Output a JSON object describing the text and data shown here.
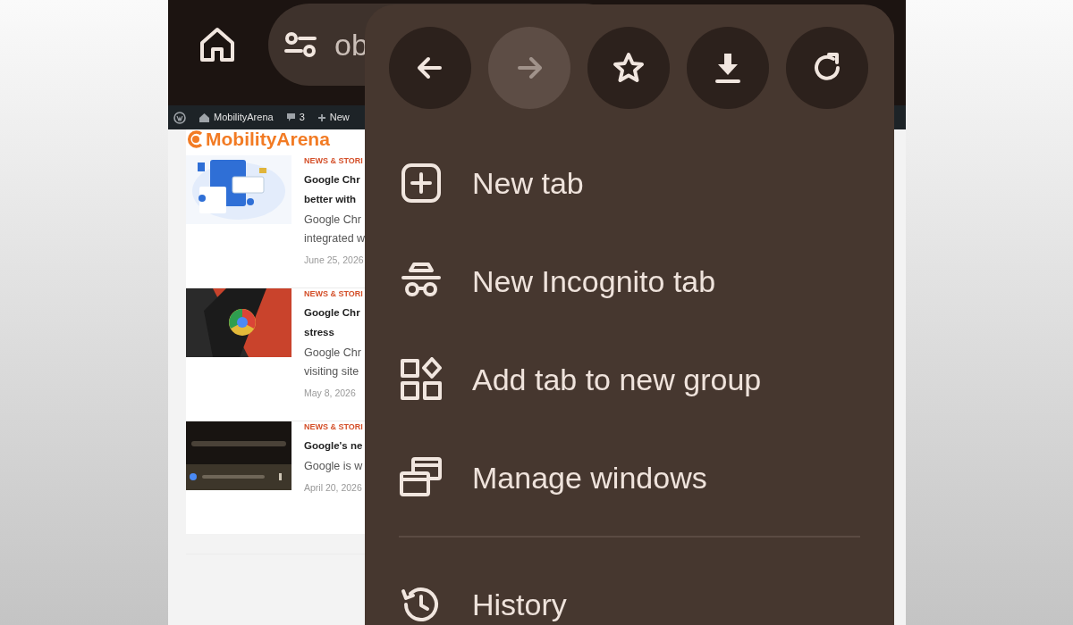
{
  "browser_bar": {
    "url_fragment": "ob"
  },
  "admin_bar": {
    "site": "MobilityArena",
    "comments": "3",
    "new": "New"
  },
  "site_logo": "MobilityArena",
  "articles": [
    {
      "category": "NEWS & STORI",
      "title_lines": [
        "Google Chr",
        "better with"
      ],
      "excerpt_lines": [
        "Google Chr",
        "integrated w"
      ],
      "date": "June 25, 2026"
    },
    {
      "category": "NEWS & STORI",
      "title_lines": [
        "Google Chr",
        "stress"
      ],
      "excerpt_lines": [
        "Google Chr",
        "visiting site"
      ],
      "date": "May 8, 2026"
    },
    {
      "category": "NEWS & STORI",
      "title_lines": [
        "Google's ne"
      ],
      "excerpt_lines": [
        "Google is w"
      ],
      "date": "April 20, 2026"
    }
  ],
  "menu": {
    "toolbar": [
      {
        "kind": "back",
        "disabled": false
      },
      {
        "kind": "forward",
        "disabled": true
      },
      {
        "kind": "star",
        "disabled": false
      },
      {
        "kind": "download",
        "disabled": false
      },
      {
        "kind": "reload",
        "disabled": false
      }
    ],
    "items": [
      {
        "kind": "new-tab",
        "label": "New tab"
      },
      {
        "kind": "incognito",
        "label": "New Incognito tab"
      },
      {
        "kind": "group",
        "label": "Add tab to new group"
      },
      {
        "kind": "windows",
        "label": "Manage windows"
      },
      {
        "kind": "divider"
      },
      {
        "kind": "history",
        "label": "History"
      }
    ]
  }
}
